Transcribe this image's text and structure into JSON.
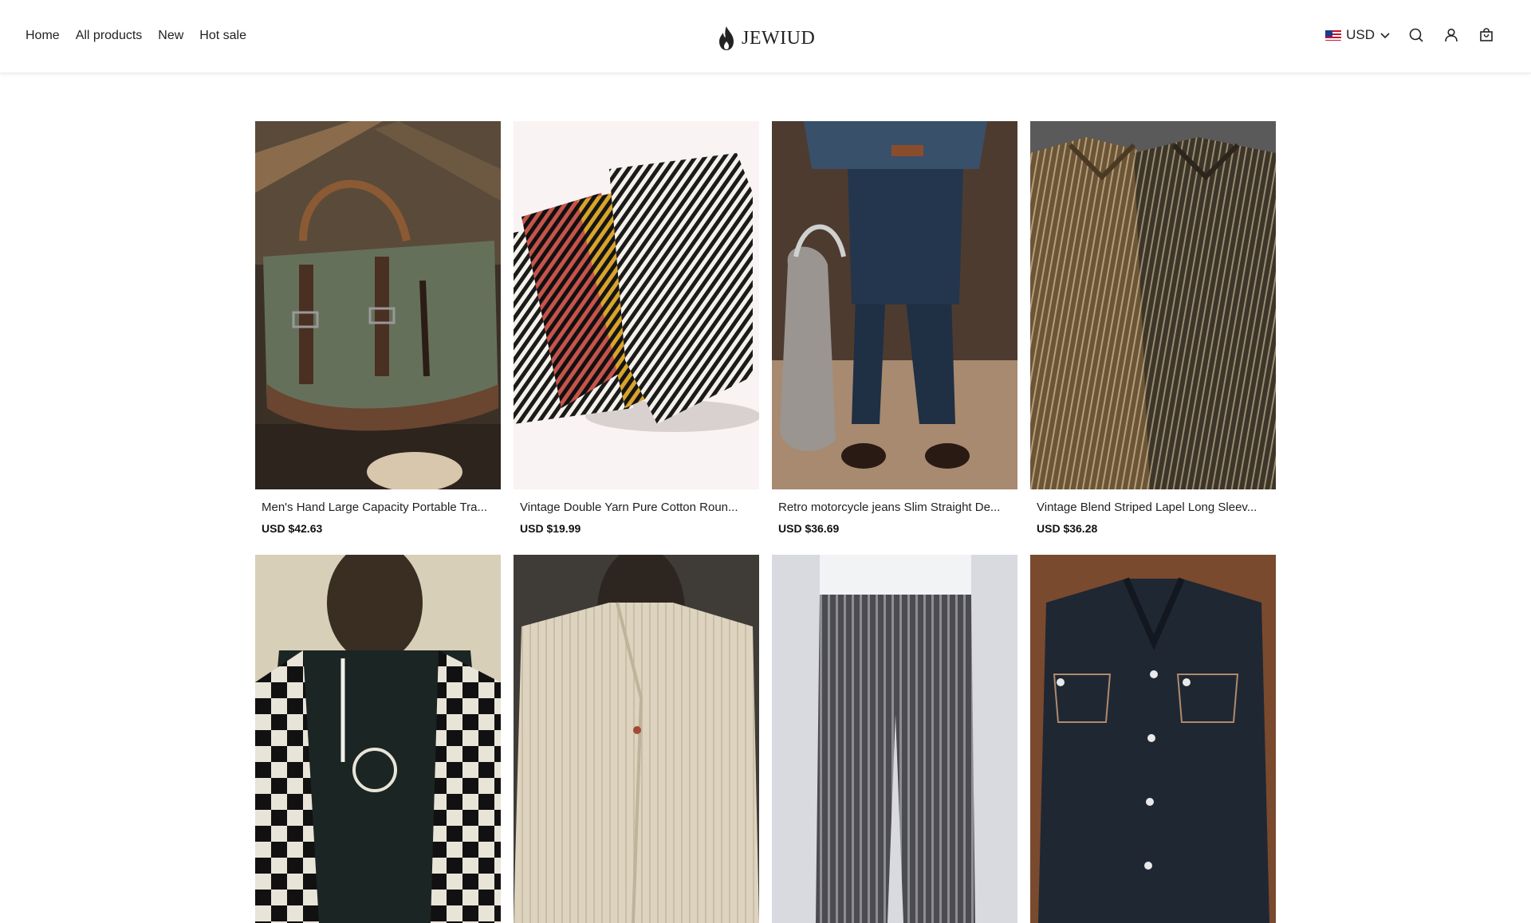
{
  "header": {
    "nav": [
      {
        "label": "Home"
      },
      {
        "label": "All products"
      },
      {
        "label": "New"
      },
      {
        "label": "Hot sale"
      }
    ],
    "logo_text": "JEWIUD",
    "currency": "USD",
    "icons": [
      "us-flag-icon",
      "chevron-down-icon",
      "search-icon",
      "account-icon",
      "cart-icon"
    ]
  },
  "products": [
    {
      "title": "Men's Hand Large Capacity Portable Tra...",
      "price": "USD $42.63",
      "image": "green canvas duffel bag with leather straps"
    },
    {
      "title": "Vintage Double Yarn Pure Cotton Roun...",
      "price": "USD $19.99",
      "image": "striped t-shirts pile"
    },
    {
      "title": "Retro motorcycle jeans Slim Straight De...",
      "price": "USD $36.69",
      "image": "man in dark denim jeans holding bag"
    },
    {
      "title": "Vintage Blend Striped Lapel Long Sleev...",
      "price": "USD $36.28",
      "image": "brown striped shirts"
    },
    {
      "title": "",
      "price": "",
      "image": "checkered sleeve hoodie"
    },
    {
      "title": "",
      "price": "",
      "image": "linen striped blazer"
    },
    {
      "title": "",
      "price": "",
      "image": "grey striped trousers"
    },
    {
      "title": "",
      "price": "",
      "image": "dark denim western shirt"
    }
  ],
  "colors": {
    "text": "#222222",
    "price": "#111111",
    "border": "#ececec"
  }
}
